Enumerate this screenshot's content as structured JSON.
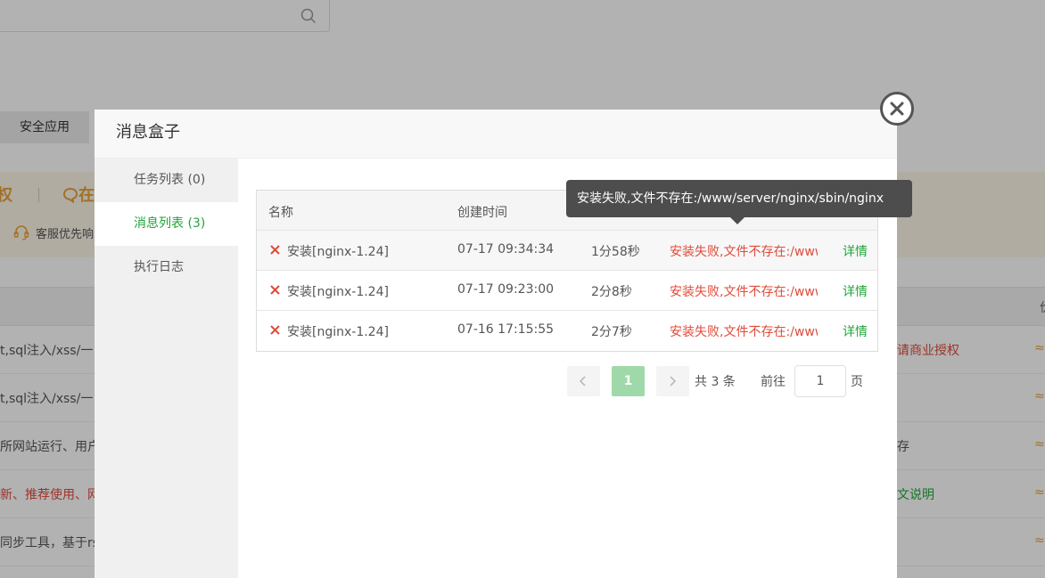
{
  "background": {
    "tab_label": "安全应用",
    "banner": {
      "item_a": "权",
      "item_b": "在",
      "service_text": "客服优先响"
    },
    "price_header": "价",
    "rows": [
      {
        "left": "t,sql注入/xss/一",
        "right": "请商业授权",
        "right_color": "#e04b3a",
        "price": "≈"
      },
      {
        "left": "t,sql注入/xss/一",
        "right": "",
        "right_color": "#555555",
        "price": "≈"
      },
      {
        "left": "所网站运行、用户",
        "right": "存",
        "right_color": "#555555",
        "price": "≈"
      },
      {
        "left": "新、推荐使用、网",
        "right": "文说明",
        "right_color": "#20a53a",
        "price": "≈",
        "left_color": "#e04b3a"
      },
      {
        "left": "同步工具，基于rs",
        "right": "",
        "right_color": "#555555",
        "price": "≈"
      }
    ]
  },
  "modal": {
    "title": "消息盒子",
    "sidebar": [
      {
        "label": "任务列表 (0)",
        "active": false
      },
      {
        "label": "消息列表 (3)",
        "active": true
      },
      {
        "label": "执行日志",
        "active": false
      }
    ],
    "table": {
      "headers": {
        "name": "名称",
        "created": "创建时间"
      },
      "rows": [
        {
          "name": "安装[nginx-1.24]",
          "created": "07-17 09:34:34",
          "duration": "1分58秒",
          "message": "安装失败,文件不存在:/www/server/nginx/sbin/nginx",
          "action": "详情"
        },
        {
          "name": "安装[nginx-1.24]",
          "created": "07-17 09:23:00",
          "duration": "2分8秒",
          "message": "安装失败,文件不存在:/www/server/nginx/sbin/nginx",
          "action": "详情"
        },
        {
          "name": "安装[nginx-1.24]",
          "created": "07-16 17:15:55",
          "duration": "2分7秒",
          "message": "安装失败,文件不存在:/www/server/nginx/sbin/nginx",
          "action": "详情"
        }
      ]
    },
    "pagination": {
      "current_page": "1",
      "total": "共 3 条",
      "goto_label": "前往",
      "goto_value": "1",
      "unit": "页"
    },
    "tooltip": "安装失败,文件不存在:/www/server/nginx/sbin/nginx"
  },
  "colors": {
    "accent": "#20a53a",
    "error": "#e04b3a",
    "banner": "#e8a33a"
  }
}
